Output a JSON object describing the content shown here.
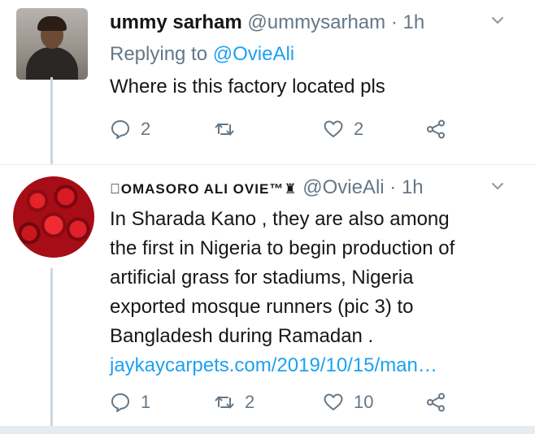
{
  "tweets": [
    {
      "display_name": "ummy sarham",
      "handle": "@ummysarham",
      "time": "· 1h",
      "replying_prefix": "Replying to",
      "replying_to": "@OvieAli",
      "text": "Where is this factory located pls",
      "reply_count": "2",
      "retweet_count": "",
      "like_count": "2"
    },
    {
      "display_name": "\u0000OMASORO ALI OVIE™♜",
      "handle": "@OvieAli",
      "time": "· 1h",
      "text_lines": [
        "In Sharada Kano , they are also among",
        "the first in Nigeria to begin production of",
        "artificial grass for stadiums, Nigeria",
        "exported mosque runners (pic 3) to",
        "Bangladesh during Ramadan ."
      ],
      "link": "jaykaycarpets.com/2019/10/15/man…",
      "reply_count": "1",
      "retweet_count": "2",
      "like_count": "10"
    }
  ],
  "icons": {
    "reply": "reply-icon",
    "retweet": "retweet-icon",
    "like": "heart-icon",
    "share": "share-icon",
    "caret": "chevron-down-icon"
  },
  "colors": {
    "text": "#14171a",
    "secondary": "#657786",
    "link": "#1da1f2",
    "thread_line": "#ccd6dd"
  }
}
